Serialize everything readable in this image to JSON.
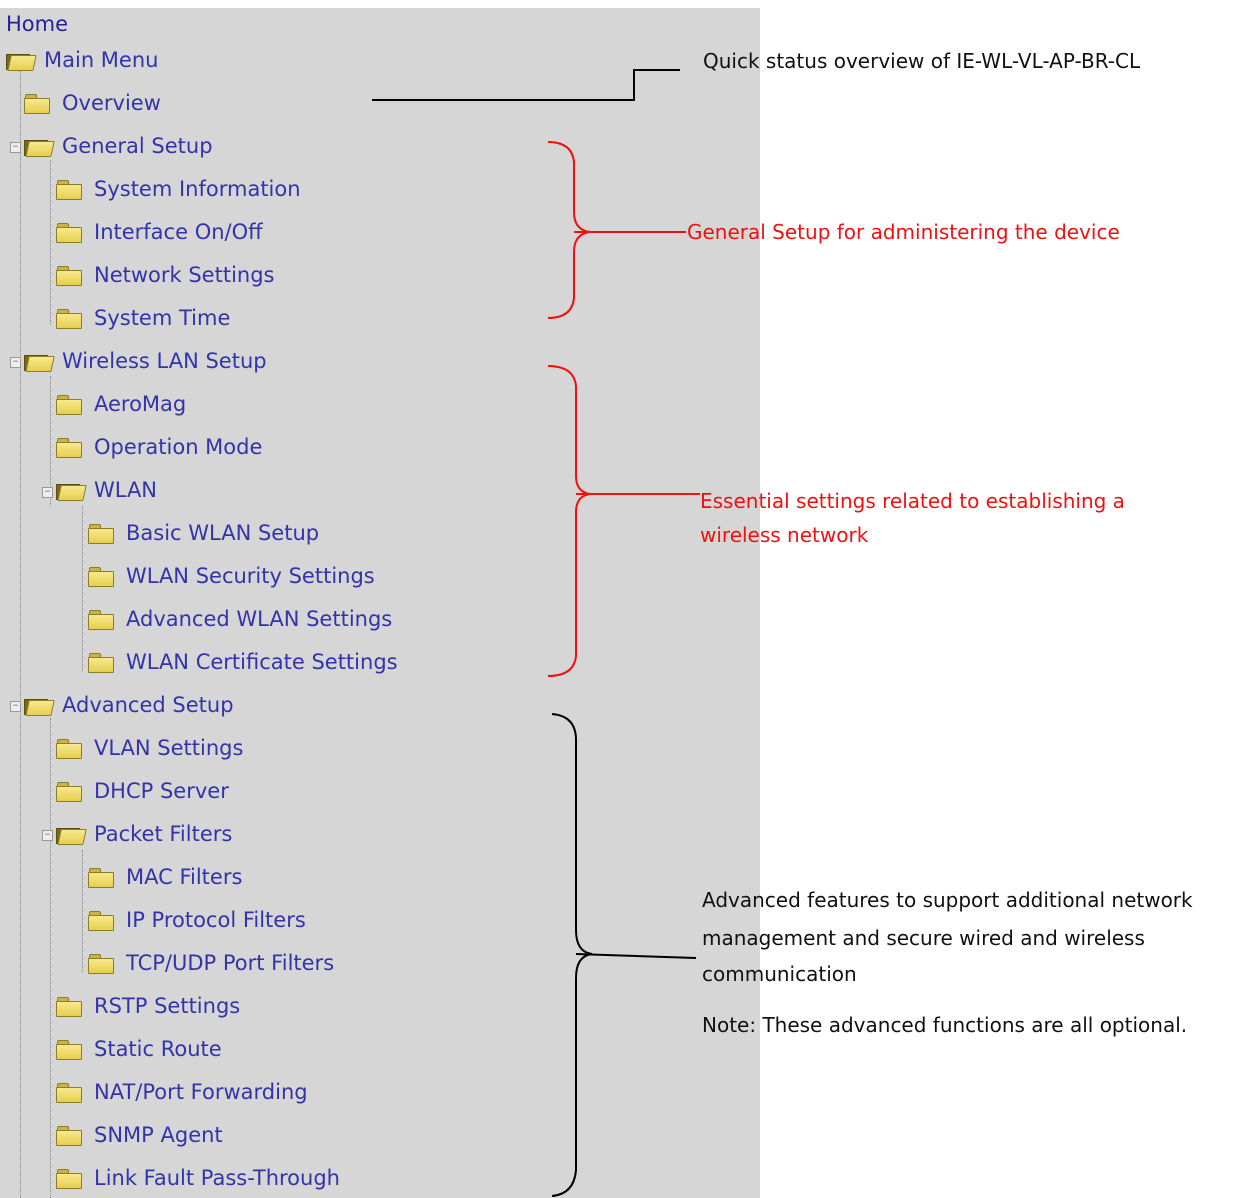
{
  "tree": {
    "home": "Home",
    "main_menu": "Main Menu",
    "items": {
      "overview": "Overview",
      "general_setup": "General Setup",
      "system_information": "System Information",
      "interface_on_off": "Interface On/Off",
      "network_settings": "Network Settings",
      "system_time": "System Time",
      "wireless_lan_setup": "Wireless LAN Setup",
      "aeromag": "AeroMag",
      "operation_mode": "Operation Mode",
      "wlan": "WLAN",
      "basic_wlan_setup": "Basic WLAN Setup",
      "wlan_security_settings": "WLAN Security Settings",
      "advanced_wlan_settings": "Advanced WLAN Settings",
      "wlan_certificate_settings": "WLAN Certificate Settings",
      "advanced_setup": "Advanced Setup",
      "vlan_settings": "VLAN Settings",
      "dhcp_server": "DHCP Server",
      "packet_filters": "Packet Filters",
      "mac_filters": "MAC Filters",
      "ip_protocol_filters": "IP Protocol Filters",
      "tcp_udp_port_filters": "TCP/UDP Port Filters",
      "rstp_settings": "RSTP Settings",
      "static_route": "Static Route",
      "nat_port_forwarding": "NAT/Port Forwarding",
      "snmp_agent": "SNMP Agent",
      "link_fault_pass_through": "Link Fault Pass-Through"
    }
  },
  "annotations": {
    "overview": "Quick status overview of IE-WL-VL-AP-BR-CL",
    "general": "General Setup for administering the device",
    "wireless_line1": "Essential settings related to establishing a",
    "wireless_line2": "wireless network",
    "advanced_line1": "Advanced features to support additional network",
    "advanced_line2": "management and secure wired and wireless",
    "advanced_line3": "communication",
    "advanced_note": "Note: These advanced functions are all optional."
  },
  "colors": {
    "tree_bg": "#d6d6d6",
    "link_text": "#3333aa",
    "annotation_red": "#ee1111",
    "annotation_black": "#111111"
  }
}
